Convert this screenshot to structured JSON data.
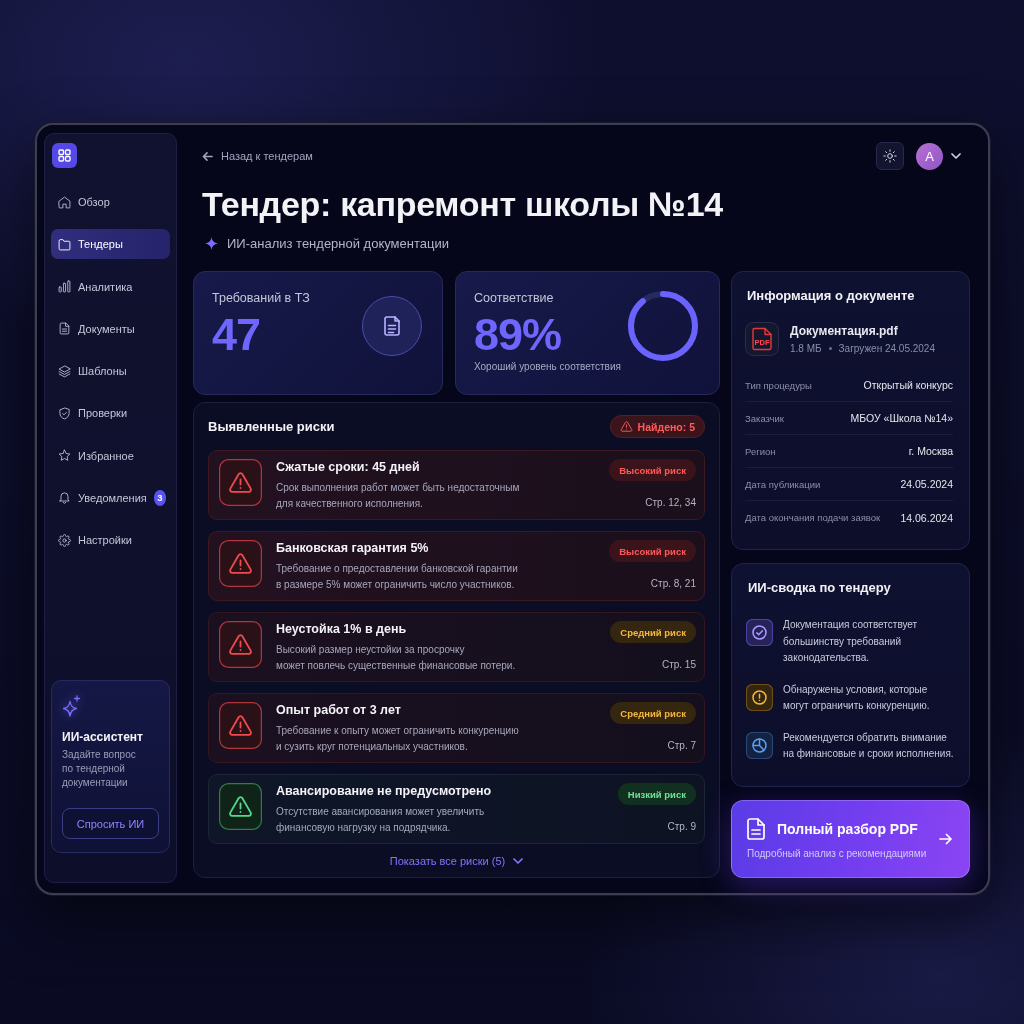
{
  "sidebar": {
    "items": [
      {
        "label": "Обзор",
        "selected": false
      },
      {
        "label": "Тендеры",
        "selected": true
      },
      {
        "label": "Аналитика",
        "selected": false
      },
      {
        "label": "Документы",
        "selected": false
      },
      {
        "label": "Шаблоны",
        "selected": false
      },
      {
        "label": "Проверки",
        "selected": false
      },
      {
        "label": "Избранное",
        "selected": false
      },
      {
        "label": "Уведомления",
        "selected": false,
        "badge": "3"
      },
      {
        "label": "Настройки",
        "selected": false
      }
    ],
    "assistant": {
      "title": "ИИ-ассистент",
      "text": "Задайте вопрос\nпо тендерной\nдокументации",
      "button": "Спросить ИИ"
    }
  },
  "header": {
    "back": "Назад к тендерам",
    "avatar": "A",
    "title": "Тендер: капремонт школы №14",
    "subtitle": "ИИ-анализ тендерной документации"
  },
  "stats": [
    {
      "kind": "count",
      "label": "Требований в ТЗ",
      "value": "47"
    },
    {
      "kind": "ring",
      "label": "Соответствие",
      "value": "89%",
      "note": "Хороший уровень соответствия",
      "level": 0.89
    }
  ],
  "risks": {
    "title": "Выявленные риски",
    "found": "Найдено: 5",
    "items": [
      {
        "kind": "high",
        "title": "Сжатые сроки: 45 дней",
        "text": "Срок выполнения работ может быть недостаточным\nдля качественного исполнения.",
        "badge": "Высокий риск",
        "pages": "Стр. 12, 34"
      },
      {
        "kind": "high",
        "title": "Банковская гарантия 5%",
        "text": "Требование о предоставлении банковской гарантии\nв размере 5% может ограничить число участников.",
        "badge": "Высокий риск",
        "pages": "Стр. 8, 21"
      },
      {
        "kind": "medium",
        "title": "Неустойка 1% в день",
        "text": "Высокий размер неустойки за просрочку\nможет повлечь существенные финансовые потери.",
        "badge": "Средний риск",
        "pages": "Стр. 15"
      },
      {
        "kind": "medium",
        "title": "Опыт работ от 3 лет",
        "text": "Требование к опыту может ограничить конкуренцию\nи сузить круг потенциальных участников.",
        "badge": "Средний риск",
        "pages": "Стр. 7"
      },
      {
        "kind": "low",
        "title": "Авансирование не предусмотрено",
        "text": "Отсутствие авансирования может увеличить\nфинансовую нагрузку на подрядчика.",
        "badge": "Низкий риск",
        "pages": "Стр. 9"
      }
    ],
    "show_all": "Показать все риски (5)"
  },
  "document": {
    "title": "Информация о документе",
    "file": {
      "type": "PDF",
      "name": "Документация.pdf",
      "size": "1.8 МБ",
      "uploaded": "Загружен 24.05.2024"
    },
    "fields": [
      {
        "label": "Тип процедуры",
        "value": "Открытый конкурс"
      },
      {
        "label": "Заказчик",
        "value": "МБОУ «Школа №14»"
      },
      {
        "label": "Регион",
        "value": "г. Москва"
      },
      {
        "label": "Дата публикации",
        "value": "24.05.2024"
      },
      {
        "label": "Дата окончания подачи заявок",
        "value": "14.06.2024"
      }
    ]
  },
  "summary": {
    "title": "ИИ-сводка по тендеру",
    "items": [
      {
        "kind": "ok",
        "text": "Документация соответствует\nбольшинству требований\nзаконодательства."
      },
      {
        "kind": "warning",
        "text": "Обнаружены условия, которые\nмогут ограничить конкуренцию."
      },
      {
        "kind": "info",
        "text": "Рекомендуется обратить внимание\nна финансовые и сроки исполнения."
      }
    ]
  },
  "cta": {
    "title": "Полный разбор PDF",
    "subtitle": "Подробный анализ с рекомендациями"
  }
}
